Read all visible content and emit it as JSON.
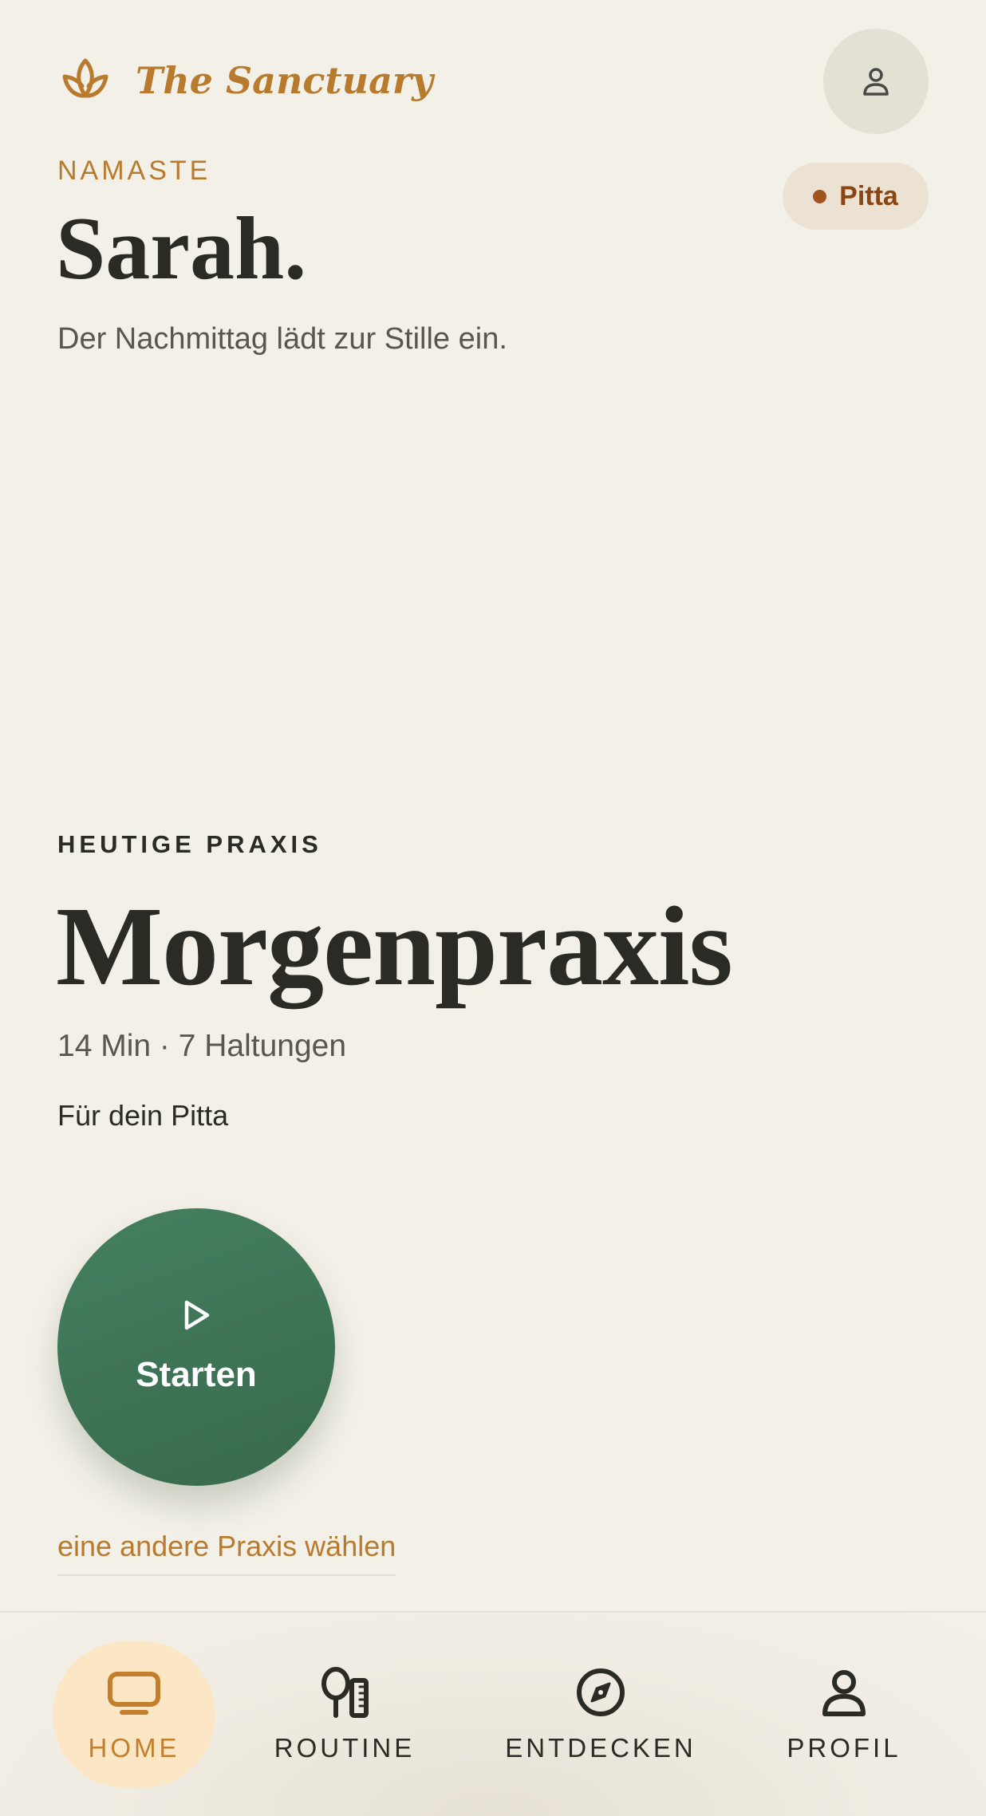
{
  "header": {
    "brand_name": "The Sanctuary",
    "logo_icon": "lotus-icon",
    "profile_icon": "user-icon"
  },
  "dosha_badge": {
    "label": "Pitta",
    "dot_color": "#a0541f"
  },
  "welcome": {
    "greeting": "NAMASTE",
    "user_name": "Sarah.",
    "subtitle": "Der Nachmittag lädt zur Stille ein."
  },
  "practice": {
    "section_label": "HEUTIGE PRAXIS",
    "title": "Morgenpraxis",
    "meta": "14 Min · 7 Haltungen",
    "for_dosha": "Für dein Pitta",
    "start_label": "Starten",
    "alternate_link": "eine andere Praxis wählen"
  },
  "bottom_nav": {
    "items": [
      {
        "label": "HOME",
        "icon": "tv-icon",
        "active": true
      },
      {
        "label": "ROUTINE",
        "icon": "mirror-comb-icon",
        "active": false
      },
      {
        "label": "ENTDECKEN",
        "icon": "compass-icon",
        "active": false
      },
      {
        "label": "PROFIL",
        "icon": "user-icon",
        "active": false
      }
    ]
  },
  "colors": {
    "background": "#f3f0e8",
    "accent_gold": "#b87a2d",
    "primary_green": "#3f765a",
    "text_dark": "#2b2b26",
    "nav_active_bg": "#fbe7c6"
  }
}
